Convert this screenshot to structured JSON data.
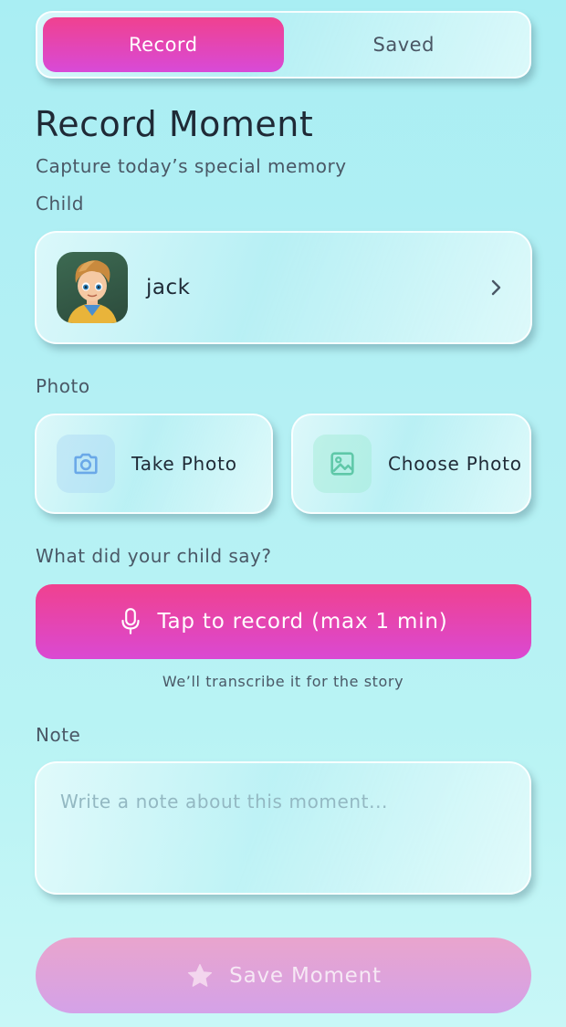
{
  "tabs": [
    {
      "label": "Record",
      "active": true
    },
    {
      "label": "Saved",
      "active": false
    }
  ],
  "header": {
    "title": "Record Moment",
    "subtitle": "Capture today’s special memory"
  },
  "child": {
    "section_label": "Child",
    "name": "jack",
    "avatar_icon": "child-avatar-photo",
    "chevron_icon": "chevron-right-icon"
  },
  "photo": {
    "section_label": "Photo",
    "take_label": "Take Photo",
    "take_icon": "camera-icon",
    "choose_label": "Choose Photo",
    "choose_icon": "image-icon"
  },
  "voice": {
    "section_label": "What did your child say?",
    "record_label": "Tap to record (max 1 min)",
    "record_icon": "microphone-icon",
    "hint": "We’ll transcribe it for the story"
  },
  "note": {
    "section_label": "Note",
    "placeholder": "Write a note about this moment...",
    "value": ""
  },
  "save": {
    "label": "Save Moment",
    "icon": "star-icon",
    "enabled": false
  },
  "colors": {
    "accent_pink": "#f0418f",
    "accent_purple": "#d84ad8",
    "background": "#b4f0f4",
    "camera_icon": "#6aa8e8",
    "image_icon": "#5fc8a8"
  }
}
